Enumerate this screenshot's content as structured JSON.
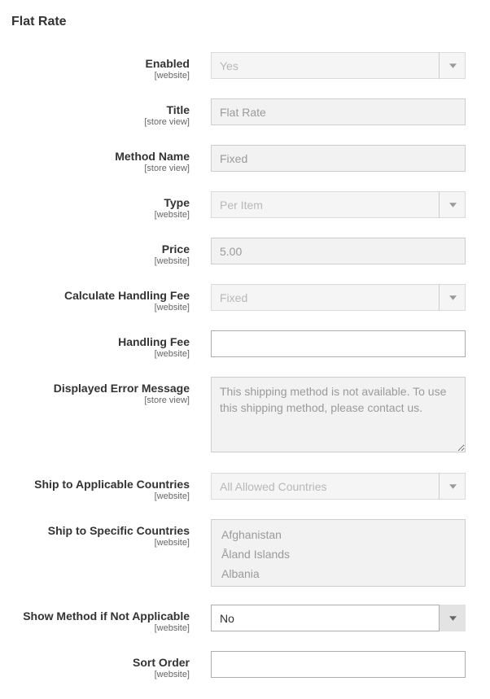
{
  "section_title": "Flat Rate",
  "scopes": {
    "website": "[website]",
    "store_view": "[store view]"
  },
  "fields": {
    "enabled": {
      "label": "Enabled",
      "value": "Yes"
    },
    "title": {
      "label": "Title",
      "value": "Flat Rate"
    },
    "method_name": {
      "label": "Method Name",
      "value": "Fixed"
    },
    "type": {
      "label": "Type",
      "value": "Per Item"
    },
    "price": {
      "label": "Price",
      "value": "5.00"
    },
    "calc_handling": {
      "label": "Calculate Handling Fee",
      "value": "Fixed"
    },
    "handling_fee": {
      "label": "Handling Fee",
      "value": ""
    },
    "error_msg": {
      "label": "Displayed Error Message",
      "value": "This shipping method is not available. To use this shipping method, please contact us."
    },
    "ship_applicable": {
      "label": "Ship to Applicable Countries",
      "value": "All Allowed Countries"
    },
    "ship_specific": {
      "label": "Ship to Specific Countries",
      "options": [
        "Afghanistan",
        "Åland Islands",
        "Albania"
      ]
    },
    "show_not_applicable": {
      "label": "Show Method if Not Applicable",
      "value": "No"
    },
    "sort_order": {
      "label": "Sort Order",
      "value": ""
    }
  }
}
